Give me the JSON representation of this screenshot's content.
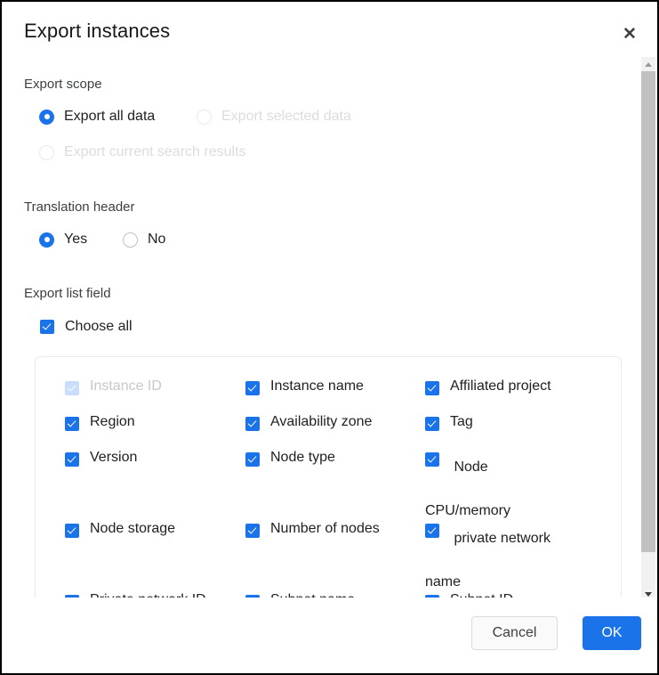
{
  "dialog": {
    "title": "Export instances",
    "close_icon": "close-icon"
  },
  "export_scope": {
    "label": "Export scope",
    "options": [
      {
        "label": "Export all data",
        "selected": true,
        "disabled": false
      },
      {
        "label": "Export selected data",
        "selected": false,
        "disabled": true
      },
      {
        "label": "Export current search results",
        "selected": false,
        "disabled": true
      }
    ]
  },
  "translation_header": {
    "label": "Translation header",
    "options": [
      {
        "label": "Yes",
        "selected": true,
        "disabled": false
      },
      {
        "label": "No",
        "selected": false,
        "disabled": false
      }
    ]
  },
  "export_list_field": {
    "label": "Export list field",
    "choose_all": {
      "label": "Choose all",
      "checked": true
    },
    "fields": [
      {
        "label": "Instance ID",
        "checked": true,
        "disabled": true
      },
      {
        "label": "Instance name",
        "checked": true,
        "disabled": false
      },
      {
        "label": "Affiliated project",
        "checked": true,
        "disabled": false
      },
      {
        "label": "Region",
        "checked": true,
        "disabled": false
      },
      {
        "label": "Availability zone",
        "checked": true,
        "disabled": false
      },
      {
        "label": "Tag",
        "checked": true,
        "disabled": false
      },
      {
        "label": "Version",
        "checked": true,
        "disabled": false
      },
      {
        "label": "Node type",
        "checked": true,
        "disabled": false
      },
      {
        "label": "Node",
        "label2": "CPU/memory",
        "checked": true,
        "disabled": false
      },
      {
        "label": "Node storage",
        "checked": true,
        "disabled": false
      },
      {
        "label": "Number of nodes",
        "checked": true,
        "disabled": false
      },
      {
        "label": "private network",
        "label2": "name",
        "checked": true,
        "disabled": false
      },
      {
        "label": "Private network ID",
        "checked": true,
        "disabled": false
      },
      {
        "label": "Subnet name",
        "checked": true,
        "disabled": false
      },
      {
        "label": "Subnet ID",
        "checked": true,
        "disabled": false
      }
    ]
  },
  "footer": {
    "cancel_label": "Cancel",
    "ok_label": "OK"
  },
  "colors": {
    "accent": "#1a73e8",
    "accent_disabled": "#c9ddfc",
    "text": "#202124",
    "text_muted": "#dadce0",
    "border": "#e8eaed"
  }
}
